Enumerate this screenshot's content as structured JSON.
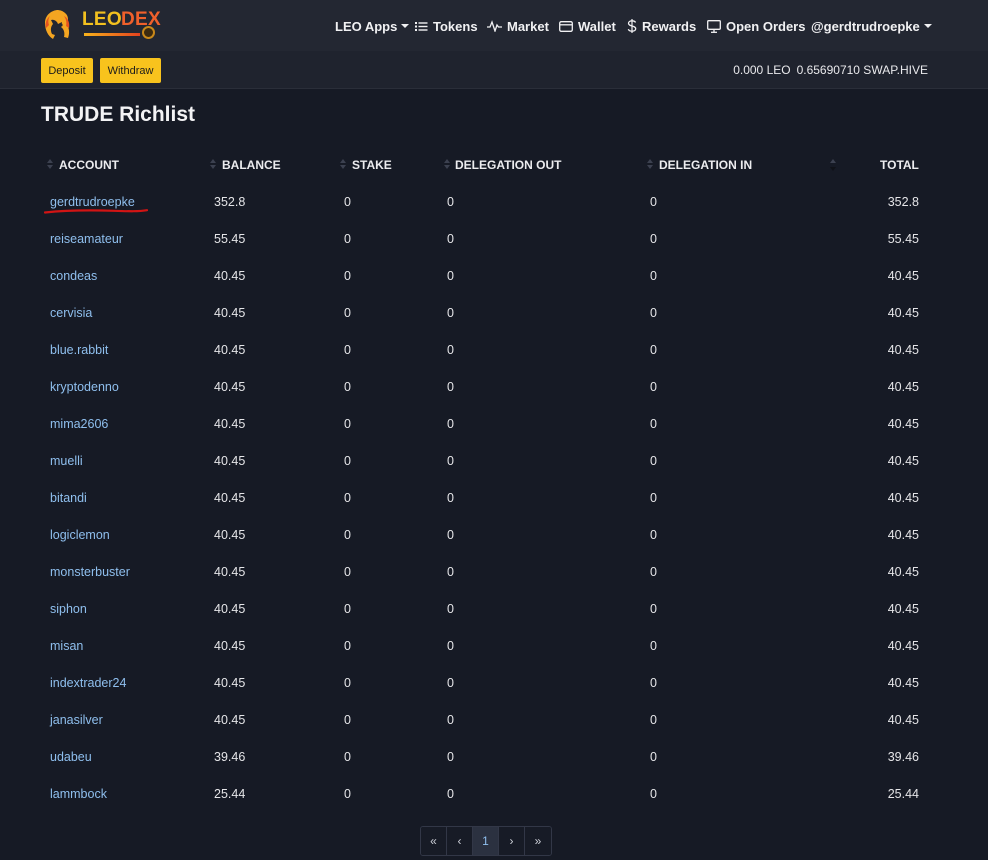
{
  "brand": {
    "leo": "LEO",
    "dex": "DEX"
  },
  "nav": {
    "leo_apps": "LEO Apps",
    "tokens": "Tokens",
    "market": "Market",
    "wallet": "Wallet",
    "rewards": "Rewards",
    "open_orders": "Open Orders",
    "user": "@gerdtrudroepke"
  },
  "actions": {
    "deposit": "Deposit",
    "withdraw": "Withdraw"
  },
  "balances": {
    "leo": "0.000 LEO",
    "swap_hive": "0.65690710 SWAP.HIVE"
  },
  "page_title": "TRUDE Richlist",
  "table": {
    "headers": {
      "account": "ACCOUNT",
      "balance": "BALANCE",
      "stake": "STAKE",
      "delegation_out": "DELEGATION OUT",
      "delegation_in": "DELEGATION IN",
      "total": "TOTAL"
    },
    "rows": [
      {
        "account": "gerdtrudroepke",
        "balance": "352.8",
        "stake": "0",
        "delegation_out": "0",
        "delegation_in": "0",
        "total": "352.8"
      },
      {
        "account": "reiseamateur",
        "balance": "55.45",
        "stake": "0",
        "delegation_out": "0",
        "delegation_in": "0",
        "total": "55.45"
      },
      {
        "account": "condeas",
        "balance": "40.45",
        "stake": "0",
        "delegation_out": "0",
        "delegation_in": "0",
        "total": "40.45"
      },
      {
        "account": "cervisia",
        "balance": "40.45",
        "stake": "0",
        "delegation_out": "0",
        "delegation_in": "0",
        "total": "40.45"
      },
      {
        "account": "blue.rabbit",
        "balance": "40.45",
        "stake": "0",
        "delegation_out": "0",
        "delegation_in": "0",
        "total": "40.45"
      },
      {
        "account": "kryptodenno",
        "balance": "40.45",
        "stake": "0",
        "delegation_out": "0",
        "delegation_in": "0",
        "total": "40.45"
      },
      {
        "account": "mima2606",
        "balance": "40.45",
        "stake": "0",
        "delegation_out": "0",
        "delegation_in": "0",
        "total": "40.45"
      },
      {
        "account": "muelli",
        "balance": "40.45",
        "stake": "0",
        "delegation_out": "0",
        "delegation_in": "0",
        "total": "40.45"
      },
      {
        "account": "bitandi",
        "balance": "40.45",
        "stake": "0",
        "delegation_out": "0",
        "delegation_in": "0",
        "total": "40.45"
      },
      {
        "account": "logiclemon",
        "balance": "40.45",
        "stake": "0",
        "delegation_out": "0",
        "delegation_in": "0",
        "total": "40.45"
      },
      {
        "account": "monsterbuster",
        "balance": "40.45",
        "stake": "0",
        "delegation_out": "0",
        "delegation_in": "0",
        "total": "40.45"
      },
      {
        "account": "siphon",
        "balance": "40.45",
        "stake": "0",
        "delegation_out": "0",
        "delegation_in": "0",
        "total": "40.45"
      },
      {
        "account": "misan",
        "balance": "40.45",
        "stake": "0",
        "delegation_out": "0",
        "delegation_in": "0",
        "total": "40.45"
      },
      {
        "account": "indextrader24",
        "balance": "40.45",
        "stake": "0",
        "delegation_out": "0",
        "delegation_in": "0",
        "total": "40.45"
      },
      {
        "account": "janasilver",
        "balance": "40.45",
        "stake": "0",
        "delegation_out": "0",
        "delegation_in": "0",
        "total": "40.45"
      },
      {
        "account": "udabeu",
        "balance": "39.46",
        "stake": "0",
        "delegation_out": "0",
        "delegation_in": "0",
        "total": "39.46"
      },
      {
        "account": "lammbock",
        "balance": "25.44",
        "stake": "0",
        "delegation_out": "0",
        "delegation_in": "0",
        "total": "25.44"
      }
    ]
  },
  "pagination": {
    "first": "«",
    "prev": "‹",
    "current": "1",
    "next": "›",
    "last": "»"
  },
  "colors": {
    "accent_yellow": "#f8c31d",
    "link_blue": "#8fbfee",
    "highlight_red": "#d11414",
    "background": "#161a25"
  },
  "icons": [
    "lion-logo-icon",
    "list-icon",
    "activity-icon",
    "wallet-icon",
    "dollar-icon",
    "monitor-icon",
    "chevron-down-icon",
    "sort-icon"
  ]
}
